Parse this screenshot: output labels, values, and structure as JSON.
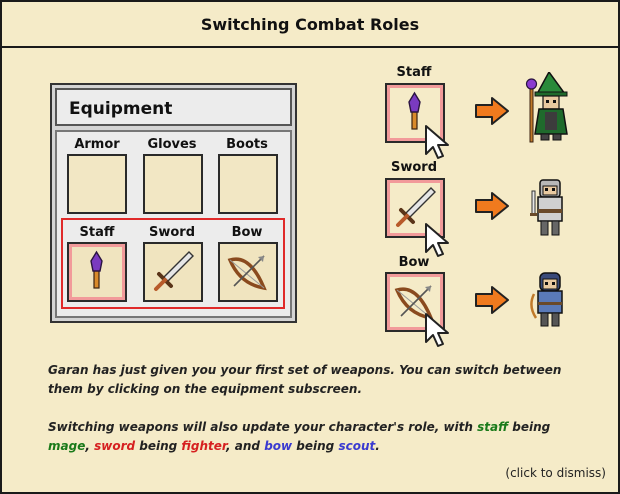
{
  "title": "Switching Combat Roles",
  "equipment": {
    "header": "Equipment",
    "armor_slots": [
      "Armor",
      "Gloves",
      "Boots"
    ],
    "weapon_slots": [
      "Staff",
      "Sword",
      "Bow"
    ]
  },
  "roles": [
    {
      "weapon": "Staff",
      "icon": "staff-icon",
      "character": "mage-character"
    },
    {
      "weapon": "Sword",
      "icon": "sword-icon",
      "character": "fighter-character"
    },
    {
      "weapon": "Bow",
      "icon": "bow-icon",
      "character": "scout-character"
    }
  ],
  "info": {
    "line1": "Garan has just given you your first set of weapons. You can switch between them by clicking on the equipment subscreen.",
    "line2_prefix": "Switching weapons will also update your character's role, with",
    "staff_word": "staff",
    "being1": " being ",
    "mage_word": "mage",
    "comma1": ", ",
    "sword_word": "sword",
    "being2": " being ",
    "fighter_word": "fighter",
    "and_text": ", and ",
    "bow_word": "bow",
    "being3": " being ",
    "scout_word": "scout",
    "period": "."
  },
  "dismiss": "(click to dismiss)",
  "colors": {
    "background": "#f5ebc8",
    "highlight": "#e02a2a",
    "arrow": "#f07a1e",
    "mage": "#1a7a1a",
    "fighter": "#d62020",
    "scout": "#3a3ad0"
  }
}
